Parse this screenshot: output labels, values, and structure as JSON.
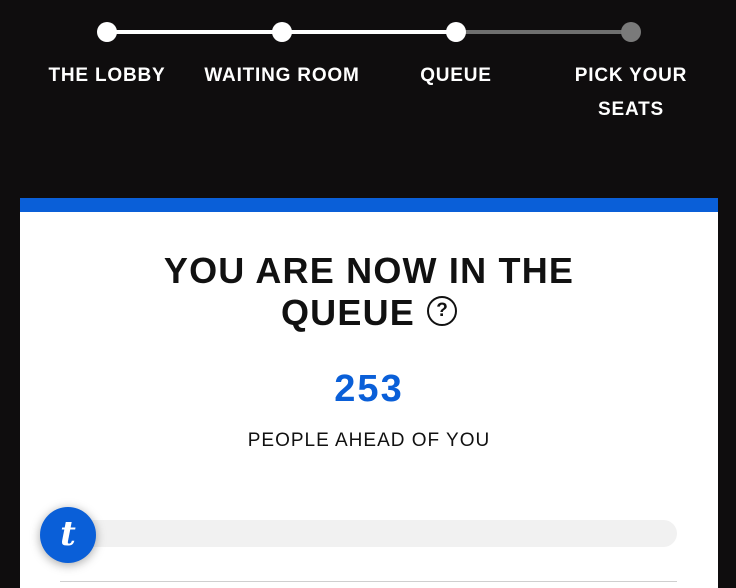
{
  "stepper": {
    "steps": [
      {
        "label": "THE LOBBY",
        "status": "done"
      },
      {
        "label": "WAITING ROOM",
        "status": "done"
      },
      {
        "label": "QUEUE",
        "status": "current"
      },
      {
        "label": "PICK YOUR SEATS",
        "status": "upcoming"
      }
    ],
    "colors": {
      "done": "#ffffff",
      "upcoming": "#6f6f6f"
    }
  },
  "queue": {
    "title": "YOU ARE NOW IN THE QUEUE",
    "help_icon": "question-circle-icon",
    "help_glyph": "?",
    "people_ahead": "253",
    "people_ahead_caption": "PEOPLE AHEAD OF YOU",
    "progress_fraction": 0
  },
  "brand_button": {
    "icon": "ticketmaster-t-icon",
    "glyph": "t"
  },
  "colors": {
    "background": "#0f0d0e",
    "accent": "#0a5fd8",
    "card": "#ffffff"
  }
}
